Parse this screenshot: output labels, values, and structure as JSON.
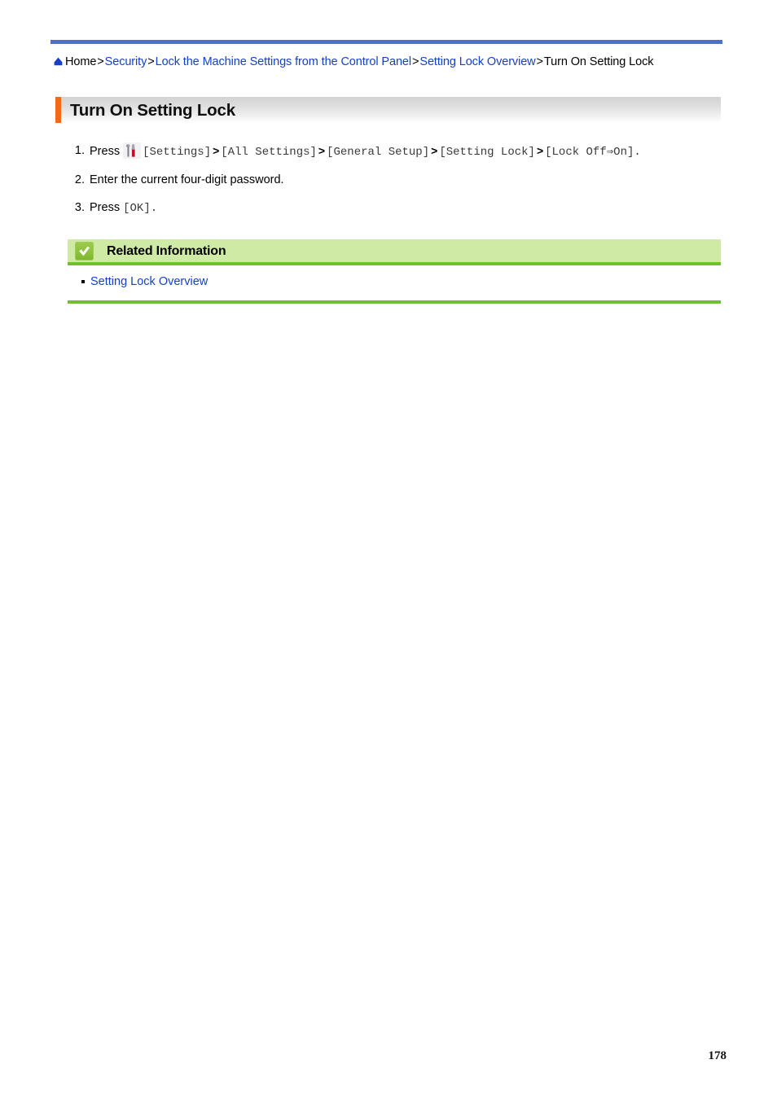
{
  "document": {
    "page_number": "178",
    "accent_colors": {
      "top_rule": "#5070d0",
      "title_accent": "#f4681b",
      "link": "#1540c8",
      "related_info_bg": "#cfeaa5",
      "related_info_rule": "#6fc02f"
    }
  },
  "breadcrumb": {
    "home_label": "Home",
    "separator": ">",
    "items": [
      {
        "label": "Security",
        "is_link": true
      },
      {
        "label": "Lock the Machine Settings from the Control Panel",
        "is_link": true
      },
      {
        "label": "Setting Lock Overview",
        "is_link": true
      },
      {
        "label": "Turn On Setting Lock",
        "is_link": false
      }
    ]
  },
  "heading": {
    "title": "Turn On Setting Lock"
  },
  "steps": [
    {
      "number": "1.",
      "prefix": "Press",
      "icon": "settings-wrench-screwdriver-icon",
      "tokens": [
        {
          "type": "mono",
          "text": "[Settings]"
        },
        {
          "type": "sep",
          "text": ">"
        },
        {
          "type": "mono",
          "text": "[All Settings]"
        },
        {
          "type": "sep",
          "text": ">"
        },
        {
          "type": "mono",
          "text": "[General Setup]"
        },
        {
          "type": "sep",
          "text": ">"
        },
        {
          "type": "mono",
          "text": "[Setting Lock]"
        },
        {
          "type": "sep",
          "text": ">"
        },
        {
          "type": "mono",
          "text": "[Lock Off⇒On]."
        }
      ]
    },
    {
      "number": "2.",
      "prefix": "Enter the current four-digit password.",
      "icon": null,
      "tokens": []
    },
    {
      "number": "3.",
      "prefix": "Press",
      "icon": null,
      "tokens": [
        {
          "type": "mono",
          "text": "[OK]."
        }
      ]
    }
  ],
  "related_information": {
    "icon": "green-check-icon",
    "title": "Related Information",
    "links": [
      {
        "label": "Setting Lock Overview"
      }
    ]
  }
}
